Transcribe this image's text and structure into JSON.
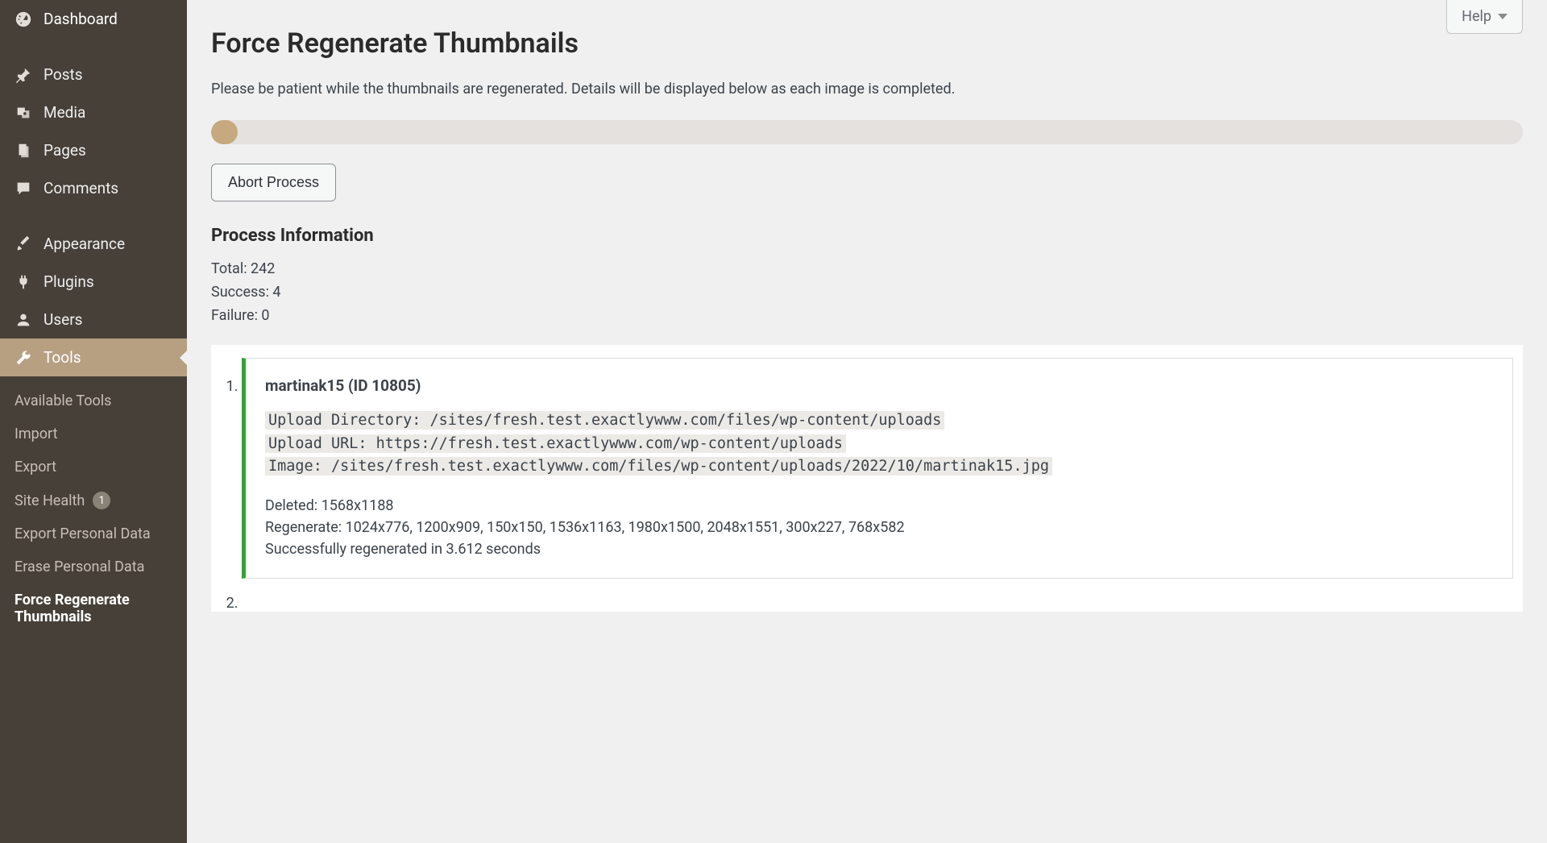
{
  "help_label": "Help",
  "sidebar": {
    "items": [
      {
        "label": "Dashboard"
      },
      {
        "label": "Posts"
      },
      {
        "label": "Media"
      },
      {
        "label": "Pages"
      },
      {
        "label": "Comments"
      },
      {
        "label": "Appearance"
      },
      {
        "label": "Plugins"
      },
      {
        "label": "Users"
      },
      {
        "label": "Tools"
      }
    ],
    "submenu": [
      {
        "label": "Available Tools"
      },
      {
        "label": "Import"
      },
      {
        "label": "Export"
      },
      {
        "label": "Site Health",
        "badge": "1"
      },
      {
        "label": "Export Personal Data"
      },
      {
        "label": "Erase Personal Data"
      },
      {
        "label": "Force Regenerate Thumbnails"
      }
    ]
  },
  "page": {
    "title": "Force Regenerate Thumbnails",
    "intro": "Please be patient while the thumbnails are regenerated. Details will be displayed below as each image is completed.",
    "abort_label": "Abort Process",
    "section_title": "Process Information",
    "stats": {
      "total_label": "Total: 242",
      "success_label": "Success: 4",
      "failure_label": "Failure: 0"
    },
    "result1": {
      "title": "martinak15 (ID 10805)",
      "upload_dir": "Upload Directory: /sites/fresh.test.exactlywww.com/files/wp-content/uploads",
      "upload_url": "Upload URL: https://fresh.test.exactlywww.com/wp-content/uploads",
      "image": "Image: /sites/fresh.test.exactlywww.com/files/wp-content/uploads/2022/10/martinak15.jpg",
      "deleted": "Deleted: 1568x1188",
      "regenerate": "Regenerate: 1024x776, 1200x909, 150x150, 1536x1163, 1980x1500, 2048x1551, 300x227, 768x582",
      "done": "Successfully regenerated in 3.612 seconds"
    }
  }
}
